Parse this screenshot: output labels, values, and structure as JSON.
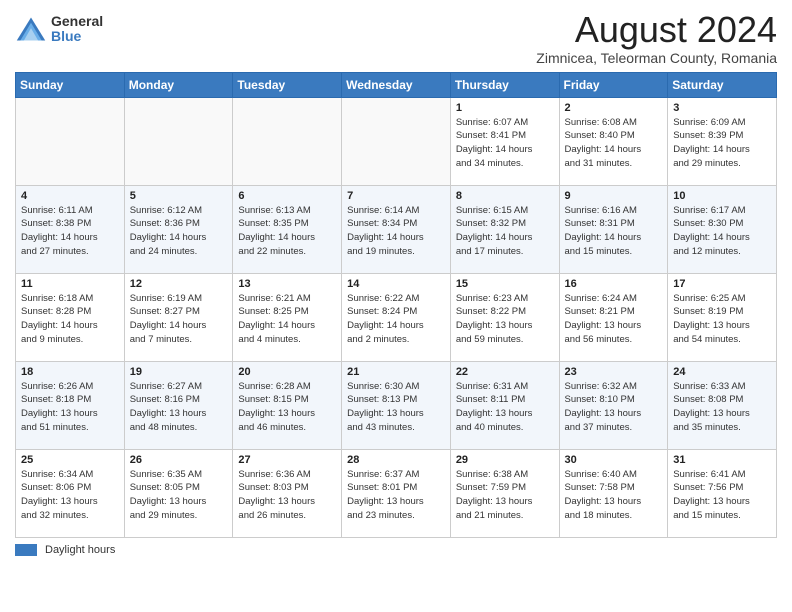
{
  "header": {
    "logo_general": "General",
    "logo_blue": "Blue",
    "month_year": "August 2024",
    "location": "Zimnicea, Teleorman County, Romania"
  },
  "footer": {
    "label": "Daylight hours"
  },
  "days_of_week": [
    "Sunday",
    "Monday",
    "Tuesday",
    "Wednesday",
    "Thursday",
    "Friday",
    "Saturday"
  ],
  "weeks": [
    {
      "row_index": 0,
      "cells": [
        {
          "day": null,
          "info": ""
        },
        {
          "day": null,
          "info": ""
        },
        {
          "day": null,
          "info": ""
        },
        {
          "day": null,
          "info": ""
        },
        {
          "day": "1",
          "info": "Sunrise: 6:07 AM\nSunset: 8:41 PM\nDaylight: 14 hours\nand 34 minutes."
        },
        {
          "day": "2",
          "info": "Sunrise: 6:08 AM\nSunset: 8:40 PM\nDaylight: 14 hours\nand 31 minutes."
        },
        {
          "day": "3",
          "info": "Sunrise: 6:09 AM\nSunset: 8:39 PM\nDaylight: 14 hours\nand 29 minutes."
        }
      ]
    },
    {
      "row_index": 1,
      "cells": [
        {
          "day": "4",
          "info": "Sunrise: 6:11 AM\nSunset: 8:38 PM\nDaylight: 14 hours\nand 27 minutes."
        },
        {
          "day": "5",
          "info": "Sunrise: 6:12 AM\nSunset: 8:36 PM\nDaylight: 14 hours\nand 24 minutes."
        },
        {
          "day": "6",
          "info": "Sunrise: 6:13 AM\nSunset: 8:35 PM\nDaylight: 14 hours\nand 22 minutes."
        },
        {
          "day": "7",
          "info": "Sunrise: 6:14 AM\nSunset: 8:34 PM\nDaylight: 14 hours\nand 19 minutes."
        },
        {
          "day": "8",
          "info": "Sunrise: 6:15 AM\nSunset: 8:32 PM\nDaylight: 14 hours\nand 17 minutes."
        },
        {
          "day": "9",
          "info": "Sunrise: 6:16 AM\nSunset: 8:31 PM\nDaylight: 14 hours\nand 15 minutes."
        },
        {
          "day": "10",
          "info": "Sunrise: 6:17 AM\nSunset: 8:30 PM\nDaylight: 14 hours\nand 12 minutes."
        }
      ]
    },
    {
      "row_index": 2,
      "cells": [
        {
          "day": "11",
          "info": "Sunrise: 6:18 AM\nSunset: 8:28 PM\nDaylight: 14 hours\nand 9 minutes."
        },
        {
          "day": "12",
          "info": "Sunrise: 6:19 AM\nSunset: 8:27 PM\nDaylight: 14 hours\nand 7 minutes."
        },
        {
          "day": "13",
          "info": "Sunrise: 6:21 AM\nSunset: 8:25 PM\nDaylight: 14 hours\nand 4 minutes."
        },
        {
          "day": "14",
          "info": "Sunrise: 6:22 AM\nSunset: 8:24 PM\nDaylight: 14 hours\nand 2 minutes."
        },
        {
          "day": "15",
          "info": "Sunrise: 6:23 AM\nSunset: 8:22 PM\nDaylight: 13 hours\nand 59 minutes."
        },
        {
          "day": "16",
          "info": "Sunrise: 6:24 AM\nSunset: 8:21 PM\nDaylight: 13 hours\nand 56 minutes."
        },
        {
          "day": "17",
          "info": "Sunrise: 6:25 AM\nSunset: 8:19 PM\nDaylight: 13 hours\nand 54 minutes."
        }
      ]
    },
    {
      "row_index": 3,
      "cells": [
        {
          "day": "18",
          "info": "Sunrise: 6:26 AM\nSunset: 8:18 PM\nDaylight: 13 hours\nand 51 minutes."
        },
        {
          "day": "19",
          "info": "Sunrise: 6:27 AM\nSunset: 8:16 PM\nDaylight: 13 hours\nand 48 minutes."
        },
        {
          "day": "20",
          "info": "Sunrise: 6:28 AM\nSunset: 8:15 PM\nDaylight: 13 hours\nand 46 minutes."
        },
        {
          "day": "21",
          "info": "Sunrise: 6:30 AM\nSunset: 8:13 PM\nDaylight: 13 hours\nand 43 minutes."
        },
        {
          "day": "22",
          "info": "Sunrise: 6:31 AM\nSunset: 8:11 PM\nDaylight: 13 hours\nand 40 minutes."
        },
        {
          "day": "23",
          "info": "Sunrise: 6:32 AM\nSunset: 8:10 PM\nDaylight: 13 hours\nand 37 minutes."
        },
        {
          "day": "24",
          "info": "Sunrise: 6:33 AM\nSunset: 8:08 PM\nDaylight: 13 hours\nand 35 minutes."
        }
      ]
    },
    {
      "row_index": 4,
      "cells": [
        {
          "day": "25",
          "info": "Sunrise: 6:34 AM\nSunset: 8:06 PM\nDaylight: 13 hours\nand 32 minutes."
        },
        {
          "day": "26",
          "info": "Sunrise: 6:35 AM\nSunset: 8:05 PM\nDaylight: 13 hours\nand 29 minutes."
        },
        {
          "day": "27",
          "info": "Sunrise: 6:36 AM\nSunset: 8:03 PM\nDaylight: 13 hours\nand 26 minutes."
        },
        {
          "day": "28",
          "info": "Sunrise: 6:37 AM\nSunset: 8:01 PM\nDaylight: 13 hours\nand 23 minutes."
        },
        {
          "day": "29",
          "info": "Sunrise: 6:38 AM\nSunset: 7:59 PM\nDaylight: 13 hours\nand 21 minutes."
        },
        {
          "day": "30",
          "info": "Sunrise: 6:40 AM\nSunset: 7:58 PM\nDaylight: 13 hours\nand 18 minutes."
        },
        {
          "day": "31",
          "info": "Sunrise: 6:41 AM\nSunset: 7:56 PM\nDaylight: 13 hours\nand 15 minutes."
        }
      ]
    }
  ]
}
